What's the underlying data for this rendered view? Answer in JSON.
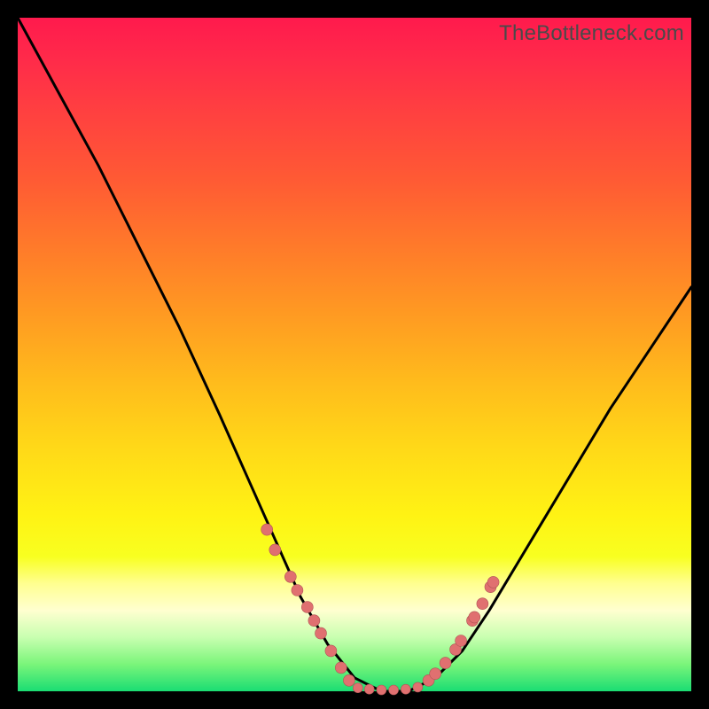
{
  "watermark": "TheBottleneck.com",
  "colors": {
    "frame": "#000000",
    "curve": "#000000",
    "marker_fill": "#e07070",
    "marker_stroke": "#b05555"
  },
  "chart_data": {
    "type": "line",
    "title": "",
    "xlabel": "",
    "ylabel": "",
    "xlim": [
      0,
      100
    ],
    "ylim": [
      0,
      100
    ],
    "x": [
      0,
      6,
      12,
      18,
      24,
      30,
      34,
      38,
      42,
      46,
      50,
      54,
      58,
      62,
      66,
      70,
      76,
      82,
      88,
      94,
      100
    ],
    "y": [
      100,
      89,
      78,
      66,
      54,
      41,
      32,
      23,
      14,
      7,
      2,
      0,
      0,
      2,
      6,
      12,
      22,
      32,
      42,
      51,
      60
    ],
    "valley_floor": {
      "x_start": 50,
      "x_end": 60,
      "y": 0
    },
    "markers_left_arm": [
      {
        "x": 37.0,
        "y": 24.0
      },
      {
        "x": 38.2,
        "y": 21.0
      },
      {
        "x": 40.5,
        "y": 17.0
      },
      {
        "x": 41.5,
        "y": 15.0
      },
      {
        "x": 43.0,
        "y": 12.5
      },
      {
        "x": 44.0,
        "y": 10.5
      },
      {
        "x": 45.0,
        "y": 8.6
      },
      {
        "x": 46.5,
        "y": 6.0
      },
      {
        "x": 48.0,
        "y": 3.5
      },
      {
        "x": 49.2,
        "y": 1.6
      }
    ],
    "markers_floor": [
      {
        "x": 50.5,
        "y": 0.5
      },
      {
        "x": 52.2,
        "y": 0.3
      },
      {
        "x": 54.0,
        "y": 0.2
      },
      {
        "x": 55.8,
        "y": 0.2
      },
      {
        "x": 57.6,
        "y": 0.3
      },
      {
        "x": 59.4,
        "y": 0.6
      }
    ],
    "markers_right_arm": [
      {
        "x": 61.0,
        "y": 1.6
      },
      {
        "x": 62.0,
        "y": 2.6
      },
      {
        "x": 63.5,
        "y": 4.2
      },
      {
        "x": 65.0,
        "y": 6.2
      },
      {
        "x": 65.8,
        "y": 7.5
      },
      {
        "x": 67.5,
        "y": 10.5
      },
      {
        "x": 67.8,
        "y": 11.0
      },
      {
        "x": 69.0,
        "y": 13.0
      },
      {
        "x": 70.2,
        "y": 15.5
      },
      {
        "x": 70.6,
        "y": 16.2
      }
    ]
  }
}
